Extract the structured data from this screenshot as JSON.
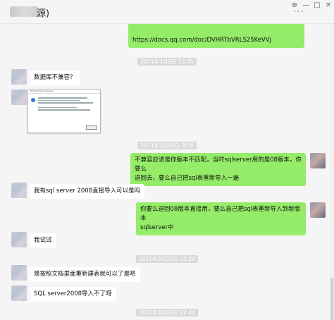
{
  "header": {
    "title": "(",
    "title_suffix": "源)",
    "more_icon": "···",
    "pin": "⊕",
    "minimize": "—",
    "maximize": "□",
    "close": "✕"
  },
  "messages": {
    "link": "https://docs.qq.com/doc/DVHRTbVRLS25KeVVj",
    "ts1": "2021年3月9日 22:45",
    "m1": "数据库不兼容？",
    "ts2": "2021年3月10日 8:58",
    "m2a": "不兼容应该是你版本不匹配，当时sqlserver用的是08版本，你要么",
    "m2b": "退回去，要么自己把sql表重新导入一遍",
    "m3": "我有sql server 2008直接导入可以是吗",
    "m4a": "你要么退回08版本直接用，要么自己把sql表重新导入到新版本",
    "m4b": "sqlserver中",
    "m5": "我试试",
    "ts3": "2021年3月10日 22:27",
    "m6": "是按照文档里面重新建表就可以了是吧",
    "m7": "SQL server2008导入不了呀",
    "ts4": "2021年3月10日 22:44",
    "screenshot_title": "Microsoft Visual Studio"
  },
  "colors": {
    "outgoing": "#95ec69",
    "incoming": "#ffffff",
    "background": "#f5f5f5"
  }
}
